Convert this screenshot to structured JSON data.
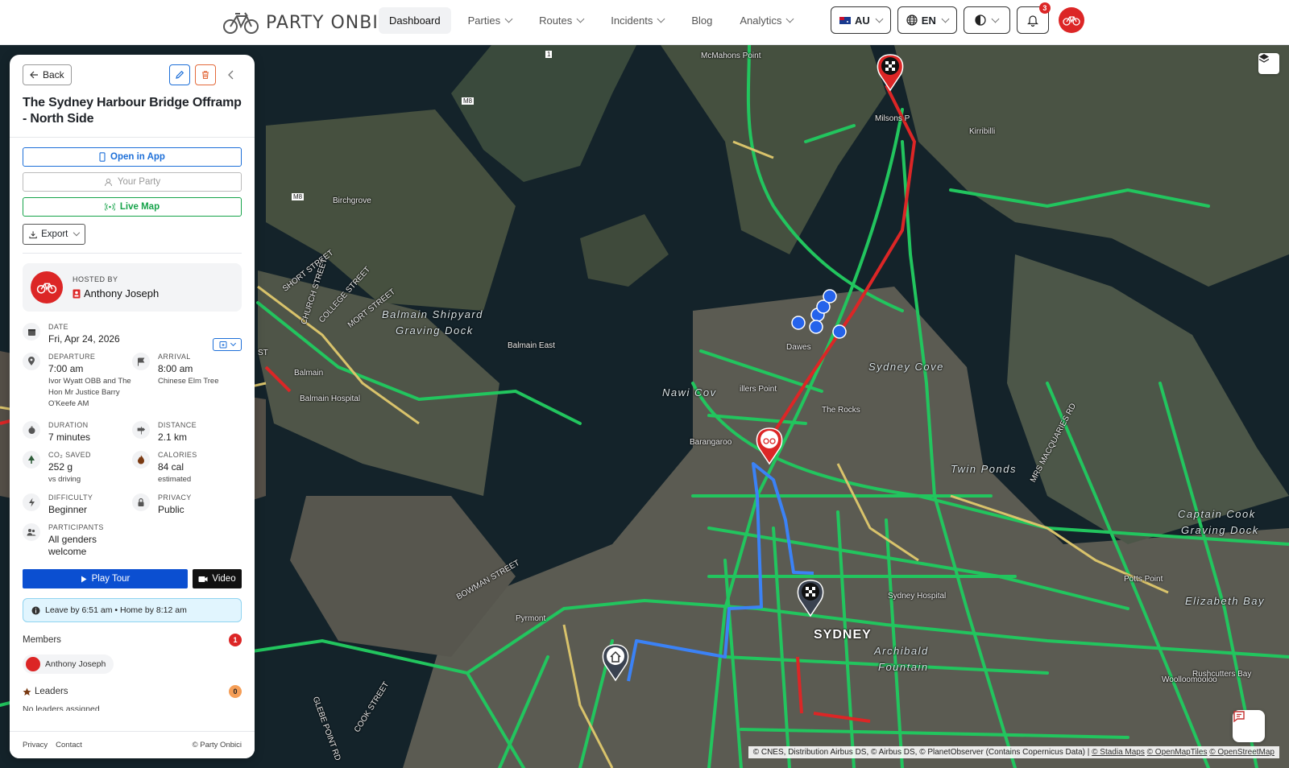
{
  "nav": {
    "brand": "PARTY ONBICI",
    "items": [
      {
        "label": "Dashboard",
        "active": true,
        "dropdown": false
      },
      {
        "label": "Parties",
        "active": false,
        "dropdown": true
      },
      {
        "label": "Routes",
        "active": false,
        "dropdown": true
      },
      {
        "label": "Incidents",
        "active": false,
        "dropdown": true
      },
      {
        "label": "Blog",
        "active": false,
        "dropdown": false
      },
      {
        "label": "Analytics",
        "active": false,
        "dropdown": true
      }
    ],
    "country": "AU",
    "language": "EN",
    "notifications_count": "3"
  },
  "panel": {
    "back_label": "Back",
    "title": "The Sydney Harbour Bridge Offramp - North Side",
    "open_app_label": "Open in App",
    "your_party_label": "Your Party",
    "live_map_label": "Live Map",
    "export_label": "Export",
    "hosted_by_label": "HOSTED BY",
    "host_name": "Anthony Joseph",
    "date_label": "DATE",
    "date_value": "Fri, Apr 24, 2026",
    "departure_label": "DEPARTURE",
    "departure_time": "7:00 am",
    "departure_place": "Ivor Wyatt OBB and The Hon Mr Justice Barry O'Keefe AM",
    "arrival_label": "ARRIVAL",
    "arrival_time": "8:00 am",
    "arrival_place": "Chinese Elm Tree",
    "duration_label": "DURATION",
    "duration_value": "7 minutes",
    "distance_label": "DISTANCE",
    "distance_value": "2.1 km",
    "co2_label": "CO₂ SAVED",
    "co2_value": "252 g",
    "co2_sub": "vs driving",
    "calories_label": "CALORIES",
    "calories_value": "84 cal",
    "calories_sub": "estimated",
    "difficulty_label": "DIFFICULTY",
    "difficulty_value": "Beginner",
    "privacy_label": "PRIVACY",
    "privacy_value": "Public",
    "participants_label": "PARTICIPANTS",
    "participants_value": "All genders welcome",
    "play_tour_label": "Play Tour",
    "video_label": "Video",
    "leave_text": "Leave by 6:51 am • Home by 8:12 am",
    "members_label": "Members",
    "members_count": "1",
    "member_name": "Anthony Joseph",
    "leaders_label": "Leaders",
    "leaders_count": "0",
    "no_leaders_text": "No leaders assigned",
    "footer_privacy": "Privacy",
    "footer_contact": "Contact",
    "footer_copy": "© Party Onbici"
  },
  "map": {
    "attribution_text": "© CNES, Distribution Airbus DS, © Airbus DS, © PlanetObserver (Contains Copernicus Data) |",
    "attribution_links": [
      "© Stadia Maps",
      "© OpenMapTiles",
      "© OpenStreetMap"
    ],
    "labels": {
      "mcmahons_point": "McMahons Point",
      "milsons_point": "Milsons P",
      "kirribilli": "Kirribilli",
      "birchgrove": "Birchgrove",
      "balmain_shipyard": "Balmain Shipyard",
      "graving_dock": "Graving Dock",
      "balmain_east": "Balmain East",
      "balmain": "Balmain",
      "balmain_hospital": "Balmain Hospital",
      "nawi_cove": "Nawi Cov",
      "millers_point": "illers Point",
      "dawes": "Dawes",
      "the_rocks": "The Rocks",
      "sydney_cove": "Sydney Cove",
      "barangaroo": "Barangaroo",
      "twin_ponds": "Twin Ponds",
      "captain_cook": "Captain Cook",
      "captain_cook_2": "Graving Dock",
      "mrs_macquaries": "MRS MACQUARIES RD",
      "potts_point": "Potts Point",
      "elizabeth_bay": "Elizabeth Bay",
      "sydney_hospital": "Sydney Hospital",
      "sydney": "SYDNEY",
      "archibald": "Archibald",
      "fountain": "Fountain",
      "pyrmont": "Pyrmont",
      "woolloomooloo": "Woolloomooloo",
      "rushcutters_bay": "Rushcutters Bay",
      "short_street": "SHORT STREET",
      "college_street": "COLLEGE STREET",
      "church_street": "CHURCH STREET",
      "mort_street": "MORT STREET",
      "bowman_street": "BOWMAN STREET",
      "glebe_point": "GLEBE POINT RD",
      "cook_street": "COOK STREET",
      "m8": "M8",
      "m8b": "M8",
      "one": "1",
      "st": "ST"
    }
  }
}
